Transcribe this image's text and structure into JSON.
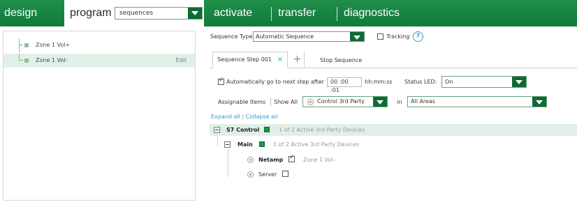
{
  "nav": {
    "design": "design",
    "program": "program",
    "program_select": "sequences",
    "activate": "activate",
    "transfer": "transfer",
    "diagnostics": "diagnostics"
  },
  "zones": [
    {
      "label": "Zone 1 Vol+"
    },
    {
      "label": "Zone 1 Vol-",
      "edit": "Edit"
    }
  ],
  "sequence": {
    "type_label": "Sequence Type",
    "type_value": "Automatic Sequence",
    "tracking_label": "Tracking",
    "help": "?"
  },
  "tabs": {
    "step": "Sequence Step 001",
    "close": "×",
    "add": "+",
    "stop": "Stop Sequence"
  },
  "auto": {
    "label": "Automatically go to next step after",
    "time": "00 :00 :01",
    "unit": "hh:mm:ss",
    "status_label": "Status LED:",
    "status_value": "On"
  },
  "assign": {
    "label": "Assignable Items",
    "show_all": "Show All",
    "filter_value": "Control 3rd Party",
    "in_label": "in",
    "area_value": "All Areas"
  },
  "expand": {
    "expand_all": "Expand all",
    "divider": "|",
    "collapse_all": "Collapse all"
  },
  "tree": {
    "s7": {
      "name": "S7 Control",
      "count": "1 of 2 Active 3rd Party Devices"
    },
    "main": {
      "name": "Main",
      "count": "1 of 2 Active 3rd Party Devices"
    },
    "netamp": {
      "name": "Netamp",
      "value": "Zone 1 Vol -"
    },
    "server": {
      "name": "Server"
    }
  }
}
